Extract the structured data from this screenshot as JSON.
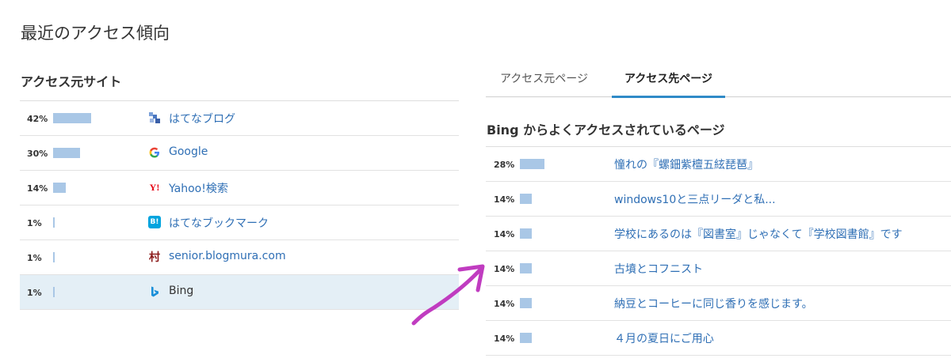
{
  "page": {
    "title": "最近のアクセス傾向"
  },
  "referrers": {
    "title": "アクセス元サイト",
    "rows": [
      {
        "percent": "42%",
        "share": 0.42,
        "name": "はてなブログ",
        "icon": "hatena-blog-icon",
        "selected": false
      },
      {
        "percent": "30%",
        "share": 0.3,
        "name": "Google",
        "icon": "google-icon",
        "selected": false
      },
      {
        "percent": "14%",
        "share": 0.14,
        "name": "Yahoo!検索",
        "icon": "yahoo-icon",
        "selected": false
      },
      {
        "percent": "1%",
        "share": 0.01,
        "name": "はてなブックマーク",
        "icon": "hatena-bookmark-icon",
        "selected": false
      },
      {
        "percent": "1%",
        "share": 0.01,
        "name": "senior.blogmura.com",
        "icon": "blogmura-icon",
        "selected": false
      },
      {
        "percent": "1%",
        "share": 0.01,
        "name": "Bing",
        "icon": "bing-icon",
        "selected": true
      }
    ]
  },
  "tabs": [
    {
      "label": "アクセス元ページ",
      "active": false
    },
    {
      "label": "アクセス先ページ",
      "active": true
    }
  ],
  "pages": {
    "title": "Bing からよくアクセスされているページ",
    "rows": [
      {
        "percent": "28%",
        "share": 0.28,
        "title": "憧れの『螺鈿紫檀五絃琵琶』"
      },
      {
        "percent": "14%",
        "share": 0.14,
        "title": "windows10と三点リーダと私..."
      },
      {
        "percent": "14%",
        "share": 0.14,
        "title": "学校にあるのは『図書室』じゃなくて『学校図書館』です"
      },
      {
        "percent": "14%",
        "share": 0.14,
        "title": "古墳とコフニスト"
      },
      {
        "percent": "14%",
        "share": 0.14,
        "title": "納豆とコーヒーに同じ香りを感じます。"
      },
      {
        "percent": "14%",
        "share": 0.14,
        "title": "４月の夏日にご用心"
      }
    ]
  },
  "colors": {
    "bar": "#a9c7e6",
    "link": "#2f6fb5",
    "tab_active": "#2f8ac7",
    "selected_row": "#e4eff6",
    "annotation": "#c03cc0"
  }
}
